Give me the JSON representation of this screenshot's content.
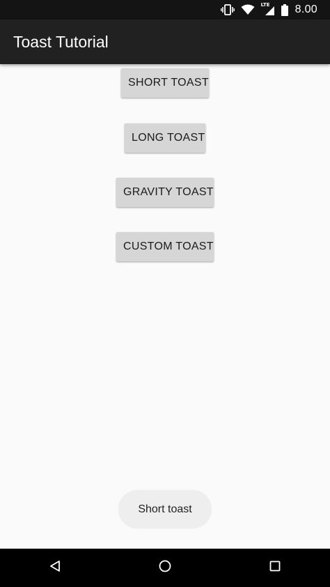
{
  "status_bar": {
    "icons": [
      "vibrate-icon",
      "wifi-icon",
      "lte-signal-icon",
      "battery-icon"
    ],
    "lte_label": "LTE",
    "time": "8.00"
  },
  "app_bar": {
    "title": "Toast Tutorial"
  },
  "buttons": {
    "short_toast": "SHORT TOAST",
    "long_toast": "LONG TOAST",
    "gravity_toast": "GRAVITY TOAST",
    "custom_toast": "CUSTOM TOAST"
  },
  "toast": {
    "message": "Short toast"
  },
  "nav_bar": {
    "icons": [
      "back-icon",
      "home-icon",
      "recents-icon"
    ]
  },
  "colors": {
    "status_bar_bg": "#141414",
    "app_bar_bg": "#212121",
    "background": "#fafafa",
    "button_bg": "#d6d6d6",
    "toast_bg": "#eeeeee",
    "nav_bar_bg": "#000000"
  }
}
